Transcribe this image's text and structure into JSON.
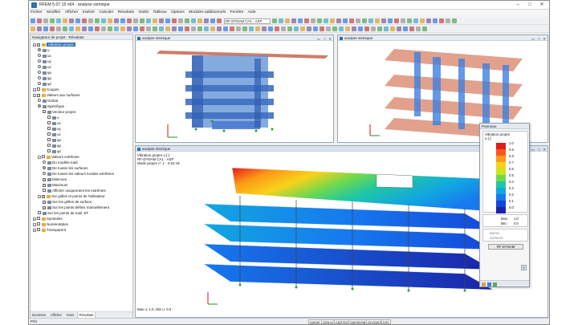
{
  "window": {
    "title": "RFEM 5.07.15 x64 - analyse sismique"
  },
  "menu": [
    "Fichier",
    "Modifier",
    "Afficher",
    "Insérer",
    "Calculer",
    "Résultats",
    "Outils",
    "Tableau",
    "Options",
    "Modules additionnels",
    "Fenêtre",
    "Aide"
  ],
  "toolbar": {
    "combo_result": "RF-DYNAM CA1 - ASP"
  },
  "navigator": {
    "title": "Navigateur de projet - Résultats",
    "tabs": [
      "Données",
      "Afficher",
      "Vues",
      "Résultats"
    ],
    "items": [
      {
        "label": "Vibration propre",
        "type": "folder-checked",
        "depth": 0,
        "selected": true
      },
      {
        "label": "u",
        "type": "radio-on",
        "depth": 1
      },
      {
        "label": "ux",
        "type": "radio",
        "depth": 1
      },
      {
        "label": "uy",
        "type": "radio",
        "depth": 1
      },
      {
        "label": "uz",
        "type": "radio",
        "depth": 1
      },
      {
        "label": "φx",
        "type": "radio",
        "depth": 1
      },
      {
        "label": "φy",
        "type": "radio",
        "depth": 1
      },
      {
        "label": "φz",
        "type": "radio",
        "depth": 1
      },
      {
        "label": "Coupes",
        "type": "folder",
        "depth": 0
      },
      {
        "label": "Valeurs aux surfaces",
        "type": "folder-checked",
        "depth": 0
      },
      {
        "label": "Global",
        "type": "radio",
        "depth": 1
      },
      {
        "label": "Spécifique",
        "type": "radio-on",
        "depth": 1
      },
      {
        "label": "Vecteur propre",
        "type": "checkbox",
        "depth": 2
      },
      {
        "label": "u",
        "type": "checkbox",
        "depth": 3
      },
      {
        "label": "ux",
        "type": "checkbox",
        "depth": 3
      },
      {
        "label": "uy",
        "type": "checkbox",
        "depth": 3
      },
      {
        "label": "uz",
        "type": "checkbox",
        "depth": 3
      },
      {
        "label": "φx",
        "type": "checkbox",
        "depth": 3
      },
      {
        "label": "φy",
        "type": "checkbox",
        "depth": 3
      },
      {
        "label": "φz",
        "type": "checkbox",
        "depth": 3
      },
      {
        "label": "Valeurs extrêmes",
        "type": "folder",
        "depth": 1
      },
      {
        "label": "Du modèle total",
        "type": "radio",
        "depth": 2
      },
      {
        "label": "De toutes les surfaces",
        "type": "radio-on",
        "depth": 2
      },
      {
        "label": "De toutes les valeurs locales extrêmes",
        "type": "radio",
        "depth": 2
      },
      {
        "label": "Minimum",
        "type": "checkbox-on",
        "depth": 2
      },
      {
        "label": "Maximum",
        "type": "checkbox-on",
        "depth": 2
      },
      {
        "label": "Afficher uniquement les extrêmes",
        "type": "checkbox",
        "depth": 2
      },
      {
        "label": "Sur grilles et points de l'utilisateur",
        "type": "folder-checked",
        "depth": 1
      },
      {
        "label": "Sur les grilles de surface",
        "type": "checkbox-on",
        "depth": 2
      },
      {
        "label": "Sur les points définis manuellement",
        "type": "checkbox-on",
        "depth": 2
      },
      {
        "label": "Sur les points de mail. EF",
        "type": "checkbox",
        "depth": 1
      },
      {
        "label": "Symboles",
        "type": "folder",
        "depth": 0
      },
      {
        "label": "Numérotation",
        "type": "folder",
        "depth": 0
      },
      {
        "label": "Transparent",
        "type": "folder",
        "depth": 0
      }
    ]
  },
  "views": {
    "top_left": {
      "title": "analyse sismique"
    },
    "top_right": {
      "title": "analyse sismique"
    },
    "main": {
      "title": "analyse sismique",
      "info_lines": [
        "Vibration propre  u [-]",
        "RF-DYNAM CA1 - ASP",
        "Mode propre n° 1 - 0.53 Hz"
      ],
      "footer": "Max u: 1.0, Min u: 0.0 -"
    }
  },
  "panel": {
    "title": "Panneau",
    "heading": "Vibration propre",
    "unit": "u [-]",
    "legend_values": [
      "1.0",
      "0.9",
      "0.8",
      "0.7",
      "0.6",
      "0.5",
      "0.4",
      "0.3",
      "0.2",
      "0.1",
      "0.0"
    ],
    "legend_colors": [
      "#e31a1c",
      "#f8581c",
      "#fd9a17",
      "#f8d21a",
      "#c7e61d",
      "#6ed84f",
      "#1fc7a4",
      "#12a7e0",
      "#1679ef",
      "#1547d8",
      "#1a24a8"
    ],
    "max_label": "Max :",
    "max_value": "1.0",
    "min_label": "Min :",
    "min_value": "0.0",
    "options": [
      "Barres",
      "Surfaces"
    ],
    "button": "RF-DYNAM"
  },
  "status": {
    "left": "Prêt",
    "buttons": [
      "SAISIE",
      "GRILLE",
      "CARTES",
      "SAISIE/OB.",
      "GLIGNES",
      "DXF"
    ]
  }
}
